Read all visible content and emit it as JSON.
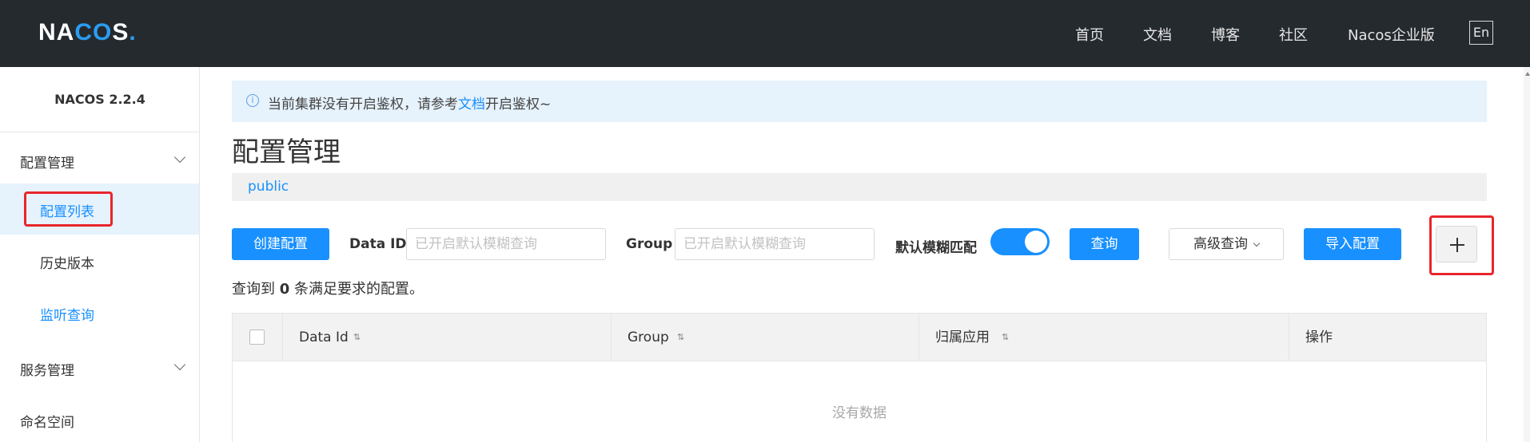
{
  "header": {
    "logo_text": "NACOS.",
    "nav": [
      "首页",
      "文档",
      "博客",
      "社区",
      "Nacos企业版"
    ],
    "lang": "En"
  },
  "sidebar": {
    "version": "NACOS 2.2.4",
    "groups": [
      {
        "label": "配置管理",
        "items": [
          "配置列表",
          "历史版本",
          "监听查询"
        ]
      },
      {
        "label": "服务管理"
      },
      {
        "label": "命名空间"
      }
    ],
    "active_item": "配置列表"
  },
  "notice": {
    "icon": "info-icon",
    "prefix": "当前集群没有开启鉴权，请参考",
    "link": "文档",
    "suffix": "开启鉴权~"
  },
  "page": {
    "title": "配置管理",
    "namespace": "public"
  },
  "toolbar": {
    "create_label": "创建配置",
    "data_id_label": "Data ID",
    "data_id_placeholder": "已开启默认模糊查询",
    "group_label": "Group",
    "group_placeholder": "已开启默认模糊查询",
    "fuzzy_label": "默认模糊匹配",
    "fuzzy_enabled": true,
    "query_label": "查询",
    "advanced_label": "高级查询",
    "import_label": "导入配置",
    "add_icon": "plus-icon"
  },
  "result": {
    "prefix": "查询到",
    "count": "0",
    "suffix": "条满足要求的配置。"
  },
  "table": {
    "columns": [
      "Data Id",
      "Group",
      "归属应用",
      "操作"
    ],
    "empty_text": "没有数据"
  },
  "colors": {
    "accent": "#1890ff",
    "topbar": "#252a2f",
    "highlight_box": "#e8262b"
  }
}
